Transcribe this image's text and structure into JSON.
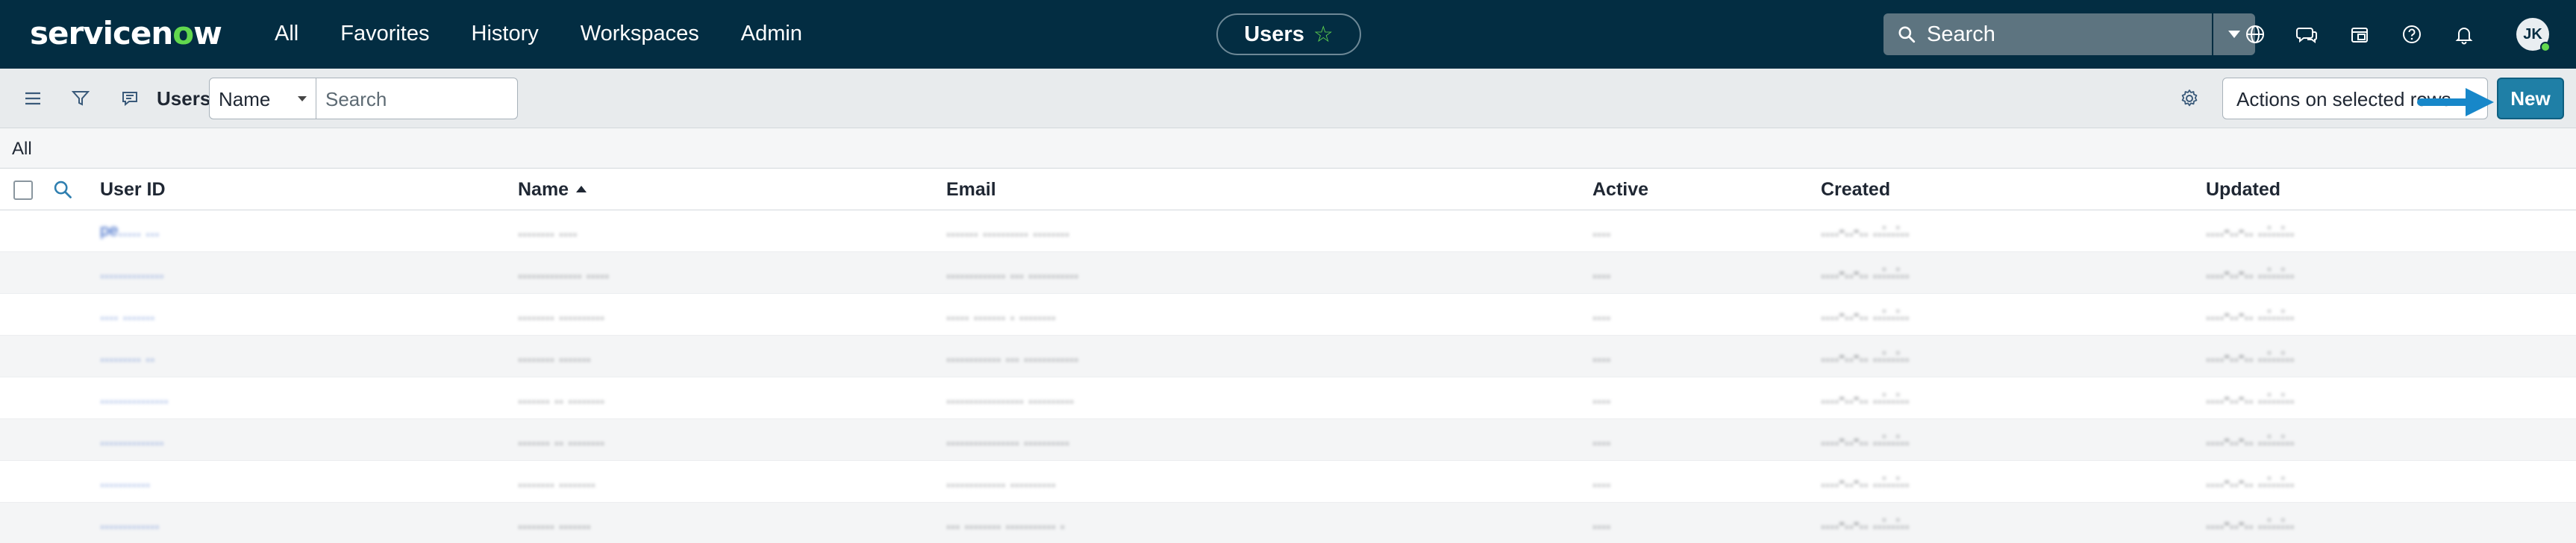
{
  "topnav": {
    "logo": {
      "pre": "servicen",
      "o": "o",
      "post": "w"
    },
    "links": [
      "All",
      "Favorites",
      "History",
      "Workspaces",
      "Admin"
    ],
    "context_title": "Users",
    "search_placeholder": "Search",
    "avatar_initials": "JK",
    "icons": [
      "globe-icon",
      "chat-icon",
      "clipboard-icon",
      "help-icon",
      "bell-icon"
    ]
  },
  "toolbar": {
    "title": "Users",
    "field_select_value": "Name",
    "search_placeholder": "Search",
    "actions_placeholder": "Actions on selected rows...",
    "new_label": "New"
  },
  "breadcrumb": {
    "label": "All"
  },
  "table": {
    "columns": [
      "User ID",
      "Name",
      "Email",
      "Active",
      "Created",
      "Updated"
    ],
    "sorted_column": "Name",
    "sort_direction": "ascending",
    "rows": [
      {
        "user_id": "pe..... ...",
        "name": "........ ....",
        "email": "....... .......... ........",
        "active": "....",
        "created": "....-..-.. ..:..:..",
        "updated": "....-..-.. ..:..:.."
      },
      {
        "user_id": "..............",
        "name": ".............. .....",
        "email": "............. ... ...........",
        "active": "....",
        "created": "....-..-.. ..:..:..",
        "updated": "....-..-.. ..:..:.."
      },
      {
        "user_id": ".... .......",
        "name": "........ ..........",
        "email": "..... ....... . ........",
        "active": "....",
        "created": "....-..-.. ..:..:..",
        "updated": "....-..-.. ..:..:.."
      },
      {
        "user_id": ".........  ..",
        "name": "........ .......",
        "email": "............ ... ............",
        "active": "....",
        "created": "....-..-.. ..:..:..",
        "updated": "....-..-.. ..:..:.."
      },
      {
        "user_id": "...............",
        "name": "....... .. ........",
        "email": "................. ..........",
        "active": "....",
        "created": "....-..-.. ..:..:..",
        "updated": "....-..-.. ..:..:.."
      },
      {
        "user_id": "..............",
        "name": "....... .. ........",
        "email": "................ ..........",
        "active": "....",
        "created": "....-..-.. ..:..:..",
        "updated": "....-..-.. ..:..:.."
      },
      {
        "user_id": "...........",
        "name": "........ ........",
        "email": "............. ..........",
        "active": "....",
        "created": "....-..-.. ..:..:..",
        "updated": "....-..-.. ..:..:.."
      },
      {
        "user_id": ".............",
        "name": "........ .......",
        "email": "... ........ ........... .",
        "active": "....",
        "created": "....-..-.. ..:..:..",
        "updated": "....-..-.. ..:..:.."
      }
    ]
  },
  "colors": {
    "nav_background": "#032d42",
    "brand_green": "#62d84e",
    "primary_button": "#1f7fa6",
    "link_blue": "#2f5fc4",
    "callout_arrow": "#1787c9"
  }
}
